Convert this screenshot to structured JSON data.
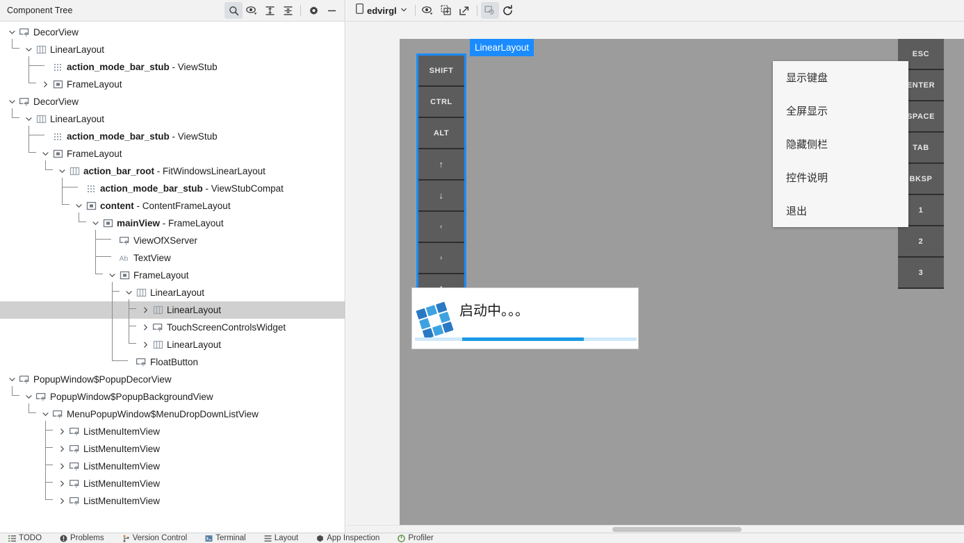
{
  "panel": {
    "title": "Component Tree",
    "toolbar": [
      {
        "name": "search-icon",
        "label": "Search",
        "active": true
      },
      {
        "name": "eye-dropdown-icon",
        "label": "Visibility"
      },
      {
        "name": "expand-all-icon",
        "label": "Expand All"
      },
      {
        "name": "collapse-all-icon",
        "label": "Collapse All"
      },
      {
        "name": "gear-icon",
        "label": "Settings"
      },
      {
        "name": "minimize-icon",
        "label": "Hide"
      }
    ]
  },
  "device_toolbar": {
    "device_label": "edvirgl",
    "buttons": [
      {
        "name": "eye-dropdown-icon",
        "label": "Toggle Overlays"
      },
      {
        "name": "layer-add-icon",
        "label": "Add Layer"
      },
      {
        "name": "pop-out-icon",
        "label": "Pop Out"
      },
      {
        "name": "live-updates-icon",
        "label": "Live Updates",
        "active": true
      },
      {
        "name": "refresh-icon",
        "label": "Refresh"
      }
    ]
  },
  "tree": [
    {
      "id": 0,
      "depth": 0,
      "label": "DecorView",
      "type": "",
      "icon": "view-unknown",
      "arrow": "down",
      "selected": false
    },
    {
      "id": 1,
      "depth": 1,
      "label": "LinearLayout",
      "type": "",
      "icon": "linear",
      "arrow": "down",
      "selected": false
    },
    {
      "id": 2,
      "depth": 2,
      "label": "action_mode_bar_stub",
      "type": "ViewStub",
      "icon": "stub",
      "arrow": "none",
      "selected": false
    },
    {
      "id": 3,
      "depth": 2,
      "label": "FrameLayout",
      "type": "",
      "icon": "frame",
      "arrow": "right",
      "selected": false
    },
    {
      "id": 4,
      "depth": 0,
      "label": "DecorView",
      "type": "",
      "icon": "view-unknown",
      "arrow": "down",
      "selected": false
    },
    {
      "id": 5,
      "depth": 1,
      "label": "LinearLayout",
      "type": "",
      "icon": "linear",
      "arrow": "down",
      "selected": false
    },
    {
      "id": 6,
      "depth": 2,
      "label": "action_mode_bar_stub",
      "type": "ViewStub",
      "icon": "stub",
      "arrow": "none",
      "selected": false
    },
    {
      "id": 7,
      "depth": 2,
      "label": "FrameLayout",
      "type": "",
      "icon": "frame",
      "arrow": "down",
      "selected": false
    },
    {
      "id": 8,
      "depth": 3,
      "label": "action_bar_root",
      "type": "FitWindowsLinearLayout",
      "icon": "linear",
      "arrow": "down",
      "selected": false
    },
    {
      "id": 9,
      "depth": 4,
      "label": "action_mode_bar_stub",
      "type": "ViewStubCompat",
      "icon": "stub",
      "arrow": "none",
      "selected": false
    },
    {
      "id": 10,
      "depth": 4,
      "label": "content",
      "type": "ContentFrameLayout",
      "icon": "frame",
      "arrow": "down",
      "selected": false
    },
    {
      "id": 11,
      "depth": 5,
      "label": "mainView",
      "type": "FrameLayout",
      "icon": "frame",
      "arrow": "down",
      "selected": false
    },
    {
      "id": 12,
      "depth": 6,
      "label": "ViewOfXServer",
      "type": "",
      "icon": "view-unknown",
      "arrow": "none",
      "selected": false
    },
    {
      "id": 13,
      "depth": 6,
      "label": "TextView",
      "type": "",
      "icon": "text",
      "arrow": "none",
      "selected": false
    },
    {
      "id": 14,
      "depth": 6,
      "label": "FrameLayout",
      "type": "",
      "icon": "frame",
      "arrow": "down",
      "selected": false
    },
    {
      "id": 15,
      "depth": 7,
      "label": "LinearLayout",
      "type": "",
      "icon": "linear",
      "arrow": "down",
      "selected": false
    },
    {
      "id": 16,
      "depth": 8,
      "label": "LinearLayout",
      "type": "",
      "icon": "linear",
      "arrow": "right",
      "selected": true
    },
    {
      "id": 17,
      "depth": 8,
      "label": "TouchScreenControlsWidget",
      "type": "",
      "icon": "view-unknown",
      "arrow": "right",
      "selected": false
    },
    {
      "id": 18,
      "depth": 8,
      "label": "LinearLayout",
      "type": "",
      "icon": "linear",
      "arrow": "right",
      "selected": false
    },
    {
      "id": 19,
      "depth": 7,
      "label": "FloatButton",
      "type": "",
      "icon": "view-unknown",
      "arrow": "none",
      "selected": false
    },
    {
      "id": 20,
      "depth": 0,
      "label": "PopupWindow$PopupDecorView",
      "type": "",
      "icon": "view-unknown",
      "arrow": "down",
      "selected": false
    },
    {
      "id": 21,
      "depth": 1,
      "label": "PopupWindow$PopupBackgroundView",
      "type": "",
      "icon": "view-unknown",
      "arrow": "down",
      "selected": false
    },
    {
      "id": 22,
      "depth": 2,
      "label": "MenuPopupWindow$MenuDropDownListView",
      "type": "",
      "icon": "view-unknown",
      "arrow": "down",
      "selected": false
    },
    {
      "id": 23,
      "depth": 3,
      "label": "ListMenuItemView",
      "type": "",
      "icon": "view-unknown",
      "arrow": "right",
      "selected": false
    },
    {
      "id": 24,
      "depth": 3,
      "label": "ListMenuItemView",
      "type": "",
      "icon": "view-unknown",
      "arrow": "right",
      "selected": false
    },
    {
      "id": 25,
      "depth": 3,
      "label": "ListMenuItemView",
      "type": "",
      "icon": "view-unknown",
      "arrow": "right",
      "selected": false
    },
    {
      "id": 26,
      "depth": 3,
      "label": "ListMenuItemView",
      "type": "",
      "icon": "view-unknown",
      "arrow": "right",
      "selected": false
    },
    {
      "id": 27,
      "depth": 3,
      "label": "ListMenuItemView",
      "type": "",
      "icon": "view-unknown",
      "arrow": "right",
      "selected": false
    }
  ],
  "preview": {
    "selection_badge": "LinearLayout",
    "left_keys": [
      "SHIFT",
      "CTRL",
      "ALT",
      "↑",
      "↓",
      "‹",
      "›",
      "A"
    ],
    "right_keys": [
      "ESC",
      "ENTER",
      "SPACE",
      "TAB",
      "BKSP",
      "1",
      "2",
      "3"
    ],
    "menu_items": [
      "显示键盘",
      "全屏显示",
      "隐藏侧栏",
      "控件说明",
      "退出"
    ],
    "splash_text": "启动中。。。"
  },
  "statusbar": [
    {
      "name": "todo",
      "label": "TODO",
      "icon": "list-icon"
    },
    {
      "name": "problems",
      "label": "Problems",
      "icon": "error-icon"
    },
    {
      "name": "version-control",
      "label": "Version Control",
      "icon": "branch-icon"
    },
    {
      "name": "terminal",
      "label": "Terminal",
      "icon": "terminal-icon"
    },
    {
      "name": "layout",
      "label": "Layout",
      "icon": "layout-icon"
    },
    {
      "name": "app-inspection",
      "label": "App Inspection",
      "icon": "inspect-icon"
    },
    {
      "name": "profiler",
      "label": "Profiler",
      "icon": "profiler-icon"
    }
  ],
  "colors": {
    "accent_blue": "#1a8cff",
    "selection_gray": "#d0d0d0",
    "device_bg": "#9c9c9c",
    "key_bg": "#5c5c5c",
    "progress_blue": "#1a9ae8"
  }
}
